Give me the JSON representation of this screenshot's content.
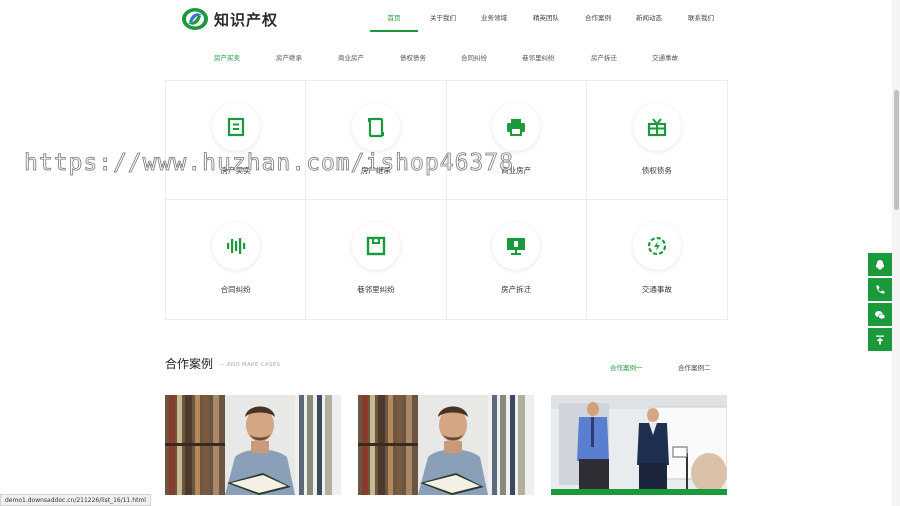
{
  "logo": {
    "text": "知识产权"
  },
  "nav": {
    "items": [
      {
        "label": "首页",
        "active": true
      },
      {
        "label": "关于我们",
        "active": false
      },
      {
        "label": "业务领域",
        "active": false
      },
      {
        "label": "精英团队",
        "active": false
      },
      {
        "label": "合作案例",
        "active": false
      },
      {
        "label": "新闻动态",
        "active": false
      },
      {
        "label": "联系我们",
        "active": false
      }
    ]
  },
  "subnav": {
    "items": [
      {
        "label": "房产买卖",
        "active": true
      },
      {
        "label": "房产继承",
        "active": false
      },
      {
        "label": "商业房产",
        "active": false
      },
      {
        "label": "债权债务",
        "active": false
      },
      {
        "label": "合同纠纷",
        "active": false
      },
      {
        "label": "巷邻里纠纷",
        "active": false
      },
      {
        "label": "房产拆迁",
        "active": false
      },
      {
        "label": "交通事故",
        "active": false
      }
    ]
  },
  "services": [
    {
      "label": "房产买卖",
      "icon": "document-icon"
    },
    {
      "label": "房产继承",
      "icon": "phone-icon"
    },
    {
      "label": "商业房产",
      "icon": "printer-icon"
    },
    {
      "label": "债权债务",
      "icon": "gift-icon"
    },
    {
      "label": "合同纠纷",
      "icon": "soundwave-icon"
    },
    {
      "label": "巷邻里纠纷",
      "icon": "box-icon"
    },
    {
      "label": "房产拆迁",
      "icon": "monitor-icon"
    },
    {
      "label": "交通事故",
      "icon": "refresh-icon"
    }
  ],
  "watermark": "https://www.huzhan.com/ishop46378",
  "cases": {
    "title": "合作案例",
    "subtitle": "AND MAKE CASES",
    "tabs": [
      {
        "label": "合作案例一",
        "active": true
      },
      {
        "label": "合作案例二",
        "active": false
      }
    ]
  },
  "side_buttons": [
    "qq-icon",
    "phone-icon",
    "wechat-icon",
    "back-to-top-icon"
  ],
  "status_url": "demo1.downsaddoc.cn/211226/list_16/11.html",
  "colors": {
    "accent": "#1a9a3c",
    "border": "#ececec"
  }
}
